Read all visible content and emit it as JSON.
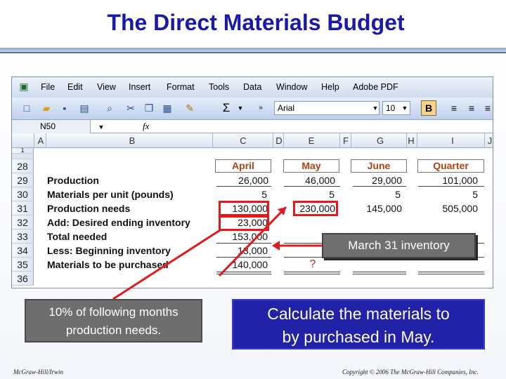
{
  "slide": {
    "title": "The Direct Materials Budget",
    "footer_left": "McGraw-Hill/Irwin",
    "footer_right": "Copyright © 2006 The McGraw-Hill Companies, Inc."
  },
  "excel": {
    "menu": [
      "File",
      "Edit",
      "View",
      "Insert",
      "Format",
      "Tools",
      "Data",
      "Window",
      "Help",
      "Adobe PDF"
    ],
    "font_name": "Arial",
    "font_size": "10",
    "bold_label": "B",
    "name_box": "N50",
    "fx_label": "fx",
    "columns": [
      "A",
      "B",
      "C",
      "D",
      "E",
      "F",
      "G",
      "H",
      "I",
      "J"
    ],
    "row_numbers": [
      "1",
      "28",
      "29",
      "30",
      "31",
      "32",
      "33",
      "34",
      "35",
      "36"
    ],
    "month_headers": [
      "April",
      "May",
      "June",
      "Quarter"
    ],
    "row_labels": [
      "Production",
      "Materials per unit (pounds)",
      "Production needs",
      "Add: Desired ending inventory",
      "Total needed",
      "Less: Beginning inventory",
      "Materials to be purchased"
    ],
    "values": {
      "april": [
        "26,000",
        "5",
        "130,000",
        "23,000",
        "153,000",
        "13,000",
        "140,000"
      ],
      "may": [
        "46,000",
        "5",
        "230,000",
        "",
        "",
        "",
        "?"
      ],
      "june": [
        "29,000",
        "5",
        "145,000"
      ],
      "quarter": [
        "101,000",
        "5",
        "505,000"
      ]
    }
  },
  "callouts": {
    "march": "March 31 inventory",
    "left_line1": "10% of following months",
    "left_line2": "production needs.",
    "right_line1": "Calculate the materials to",
    "right_line2": "by purchased in May."
  },
  "colors": {
    "title": "#1a1aa8",
    "month_header": "#b04010",
    "highlight": "#e21a1a",
    "callout_blue": "#2222a8",
    "callout_gray": "#6e6e6e"
  }
}
